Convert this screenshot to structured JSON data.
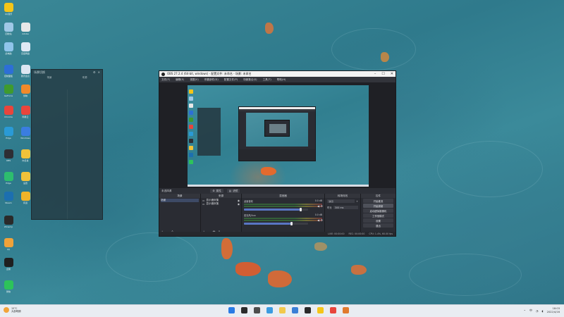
{
  "desktop": {
    "icons": [
      {
        "label": "QQ音乐",
        "color": "#f5c518",
        "icon": "music-icon"
      },
      {
        "label": "回收站",
        "color": "#9fc8e6",
        "icon": "recycle-bin-icon"
      },
      {
        "label": "Adobe",
        "color": "#e8e8e8",
        "icon": "app-icon"
      },
      {
        "label": "此电脑",
        "color": "#8fc4ea",
        "icon": "computer-icon"
      },
      {
        "label": "百度网盘",
        "color": "#dfe9f5",
        "icon": "cloud-icon"
      },
      {
        "label": "控制面板",
        "color": "#2d6fd6",
        "icon": "control-panel-icon"
      },
      {
        "label": "腾讯会议",
        "color": "#dce6f2",
        "icon": "meeting-icon"
      },
      {
        "label": "GeForce",
        "color": "#3f9b2e",
        "icon": "nvidia-icon"
      },
      {
        "label": "剪映",
        "color": "#f08a2a",
        "icon": "video-icon"
      },
      {
        "label": "Chrome",
        "color": "#e8453c",
        "icon": "chrome-icon"
      },
      {
        "label": "网易云",
        "color": "#e8453c",
        "icon": "music-icon"
      },
      {
        "label": "Edge",
        "color": "#2a9ad6",
        "icon": "edge-icon"
      },
      {
        "label": "Windows",
        "color": "#3a7de0",
        "icon": "windows-icon"
      },
      {
        "label": "OBS",
        "color": "#2e2e34",
        "icon": "obs-icon"
      },
      {
        "label": "向日葵",
        "color": "#f0c23a",
        "icon": "app-icon"
      },
      {
        "label": "Edge",
        "color": "#2dbd6e",
        "icon": "edge-icon"
      },
      {
        "label": "设置",
        "color": "#f0c23a",
        "icon": "app-icon"
      },
      {
        "label": "Steam",
        "color": "#1c6fb0",
        "icon": "steam-icon"
      },
      {
        "label": "有道",
        "color": "#f0b429",
        "icon": "app-icon"
      },
      {
        "label": "Winamp",
        "color": "#2a2a2a",
        "icon": "app-icon"
      },
      {
        "label": "QQ",
        "color": "#f0a23a",
        "icon": "qq-icon"
      },
      {
        "label": "企鹅",
        "color": "#1f1f1f",
        "icon": "qq-icon"
      },
      {
        "label": "微信",
        "color": "#2dc35a",
        "icon": "wechat-icon"
      }
    ]
  },
  "side_panel": {
    "title": "场景切换",
    "col_left": "场景",
    "col_right": "来源"
  },
  "obs": {
    "title": "OBS 27.2.4 (64-bit, windows) - 配置文件: 未命名 - 场景: 未命名",
    "menu": [
      "文件(F)",
      "编辑(E)",
      "视图(V)",
      "停靠部件(D)",
      "配置文件(P)",
      "场景集合(S)",
      "工具(T)",
      "帮助(H)"
    ],
    "toolbar": {
      "source_label": "未选择源",
      "properties": "属性",
      "filters": "滤镜"
    },
    "docks": {
      "scenes": {
        "header": "场景",
        "items": [
          "场景"
        ]
      },
      "sources": {
        "header": "来源",
        "items": [
          "显示器采集",
          "显示器采集"
        ]
      },
      "mixer": {
        "header": "混音器",
        "channels": [
          {
            "name": "桌面音频",
            "db": "0.0 dB",
            "level": 0.9
          },
          {
            "name": "麦克风/Aux",
            "db": "0.0 dB",
            "level": 0.75
          }
        ]
      },
      "transitions": {
        "header": "转场特效",
        "effect_label": "淡出",
        "duration_label": "时长",
        "duration_value": "300 ms"
      },
      "controls": {
        "header": "控件",
        "buttons": [
          "开始推流",
          "开始录制",
          "启动虚拟摄像机",
          "工作室模式",
          "设置",
          "退出"
        ]
      }
    },
    "status": {
      "live": "LIVE: 00:00:00",
      "rec": "REC: 00:00:00",
      "cpu": "CPU: 1.4%, 60.00 fps"
    }
  },
  "taskbar": {
    "weather": {
      "temp": "15°C",
      "desc": "大部晴朗"
    },
    "lang": "中",
    "time": "18:03",
    "date": "2022/4/16"
  }
}
